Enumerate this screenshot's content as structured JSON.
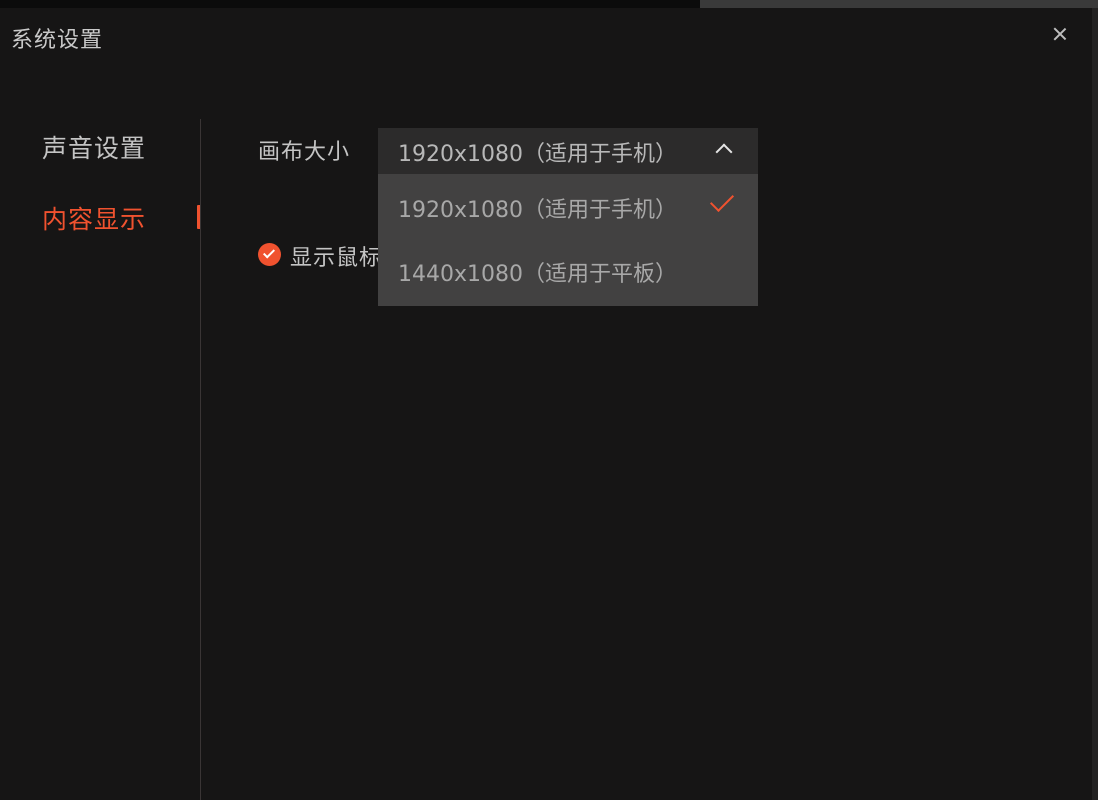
{
  "window": {
    "title": "系统设置"
  },
  "sidebar": {
    "items": [
      {
        "label": "声音设置",
        "active": false
      },
      {
        "label": "内容显示",
        "active": true
      }
    ]
  },
  "content": {
    "canvas_size": {
      "label": "画布大小",
      "selected": "1920x1080（适用于手机）",
      "options": [
        {
          "label": "1920x1080（适用于手机）",
          "selected": true
        },
        {
          "label": "1440x1080（适用于平板）",
          "selected": false
        }
      ]
    },
    "show_cursor": {
      "label": "显示鼠标",
      "checked": true
    }
  },
  "colors": {
    "accent": "#f0522f",
    "background": "#161515",
    "dropdown": "#424141"
  }
}
